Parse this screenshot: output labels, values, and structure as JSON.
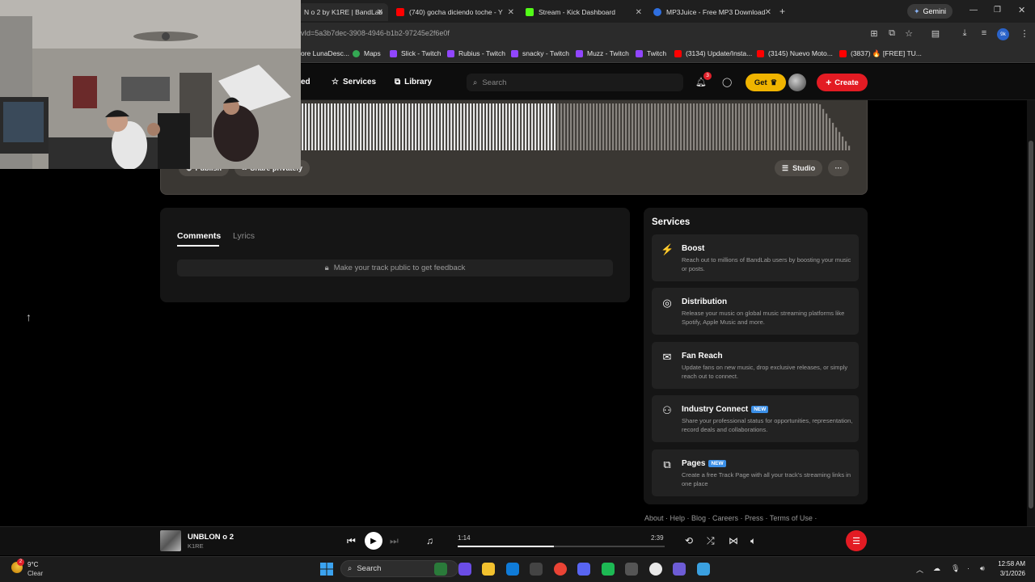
{
  "browser": {
    "tabs": [
      {
        "title": "N o 2 by K1RE | BandLab",
        "fav": "#e31b23",
        "active": true
      },
      {
        "title": "(740) gocha diciendo toche - Y",
        "fav": "#ff0000"
      },
      {
        "title": "Stream - Kick Dashboard",
        "fav": "#53fc18"
      },
      {
        "title": "MP3Juice - Free MP3 Download",
        "fav": "#2f6fe0"
      }
    ],
    "gemini_label": "Gemini",
    "url": "vId=5a3b7dec-3908-4946-b1b2-97245e2f6e0f",
    "profile_badge": "9k",
    "bookmarks": [
      {
        "label": "ore LunaDesc...",
        "fav": "#444"
      },
      {
        "label": "Maps",
        "fav": "#34a853"
      },
      {
        "label": "Slick - Twitch",
        "fav": "#9146ff"
      },
      {
        "label": "Rubius - Twitch",
        "fav": "#9146ff"
      },
      {
        "label": "snacky - Twitch",
        "fav": "#9146ff"
      },
      {
        "label": "Muzz - Twitch",
        "fav": "#9146ff"
      },
      {
        "label": "Twitch",
        "fav": "#9146ff"
      },
      {
        "label": "(3134) Update/Insta...",
        "fav": "#ff0000"
      },
      {
        "label": "(3145) Nuevo Moto...",
        "fav": "#ff0000"
      },
      {
        "label": "(3837) 🔥 [FREE] TU...",
        "fav": "#ff0000"
      }
    ]
  },
  "header": {
    "nav_partial": "ed",
    "services_label": "Services",
    "library_label": "Library",
    "search_placeholder": "Search",
    "notif_count": "3",
    "get_label": "Get",
    "create_label": "Create"
  },
  "track": {
    "publish_label": "Publish",
    "share_label": "Share privately",
    "studio_label": "Studio",
    "more_label": "···",
    "waveform_played_fraction": 0.46
  },
  "comments": {
    "tab_comments": "Comments",
    "tab_lyrics": "Lyrics",
    "feedback_text": "Make your track public to get feedback"
  },
  "services": {
    "title": "Services",
    "items": [
      {
        "title": "Boost",
        "icon": "lightning-icon",
        "glyph": "⚡",
        "desc": "Reach out to millions of BandLab users by boosting your music or posts.",
        "new": false
      },
      {
        "title": "Distribution",
        "icon": "distribution-icon",
        "glyph": "◎",
        "desc": "Release your music on global music streaming platforms like Spotify, Apple Music and more.",
        "new": false
      },
      {
        "title": "Fan Reach",
        "icon": "mail-icon",
        "glyph": "✉",
        "desc": "Update fans on new music, drop exclusive releases, or simply reach out to connect.",
        "new": false
      },
      {
        "title": "Industry Connect",
        "icon": "people-icon",
        "glyph": "⚇",
        "desc": "Share your professional status for opportunities, representation, record deals and collaborations.",
        "new": true
      },
      {
        "title": "Pages",
        "icon": "pages-icon",
        "glyph": "⧉",
        "desc": "Create a free Track Page with all your track's streaming links in one place",
        "new": true
      }
    ],
    "new_label": "NEW"
  },
  "footer": {
    "links": "About · Help · Blog · Careers · Press · Terms of Use ·"
  },
  "player": {
    "title": "UNBLON o 2",
    "artist": "K1RE",
    "current_time": "1:14",
    "total_time": "2:39",
    "progress_fraction": 0.465
  },
  "taskbar": {
    "temp": "9°C",
    "condition": "Clear",
    "weather_badge": "2",
    "search_label": "Search",
    "time": "12:58 AM",
    "date": "3/1/2026",
    "apps": [
      "#2a7a3a",
      "#6b4de6",
      "#f2c12e",
      "#0f7bd8",
      "#444",
      "#ea4335",
      "#5865f2",
      "#1db954",
      "#555",
      "#e8e8e8",
      "#6d5cd6",
      "#3aa0e0"
    ]
  }
}
